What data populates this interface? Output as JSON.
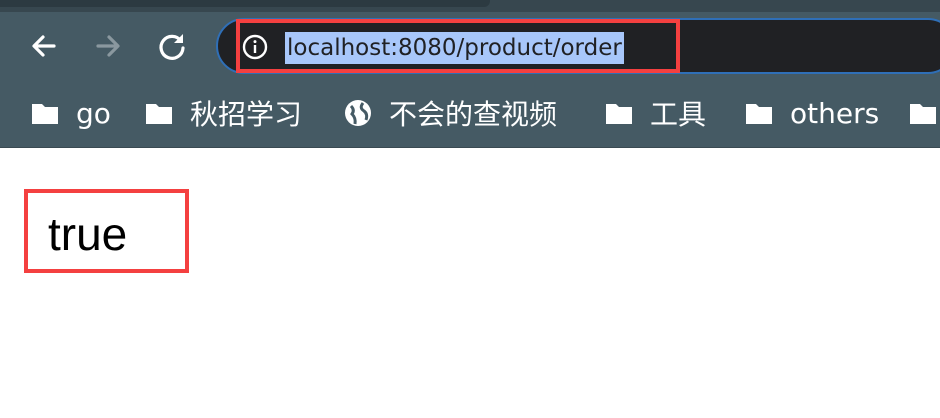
{
  "browser": {
    "address_bar": {
      "url": "localhost:8080/product/order",
      "selected": true
    },
    "nav": {
      "back_icon": "arrow-left-icon",
      "forward_icon": "arrow-right-icon",
      "reload_icon": "reload-icon"
    },
    "bookmarks": [
      {
        "label": "go",
        "icon": "folder-icon"
      },
      {
        "label": "秋招学习",
        "icon": "folder-icon"
      },
      {
        "label": "不会的查视频",
        "icon": "globe-icon"
      },
      {
        "label": "工具",
        "icon": "folder-icon"
      },
      {
        "label": "others",
        "icon": "folder-icon"
      }
    ]
  },
  "page": {
    "body_text": "true"
  },
  "annotations": {
    "highlight_color": "#f44040"
  },
  "colors": {
    "toolbar": "#455a64",
    "omnibox": "#202124",
    "selection": "#a8c7fa"
  }
}
